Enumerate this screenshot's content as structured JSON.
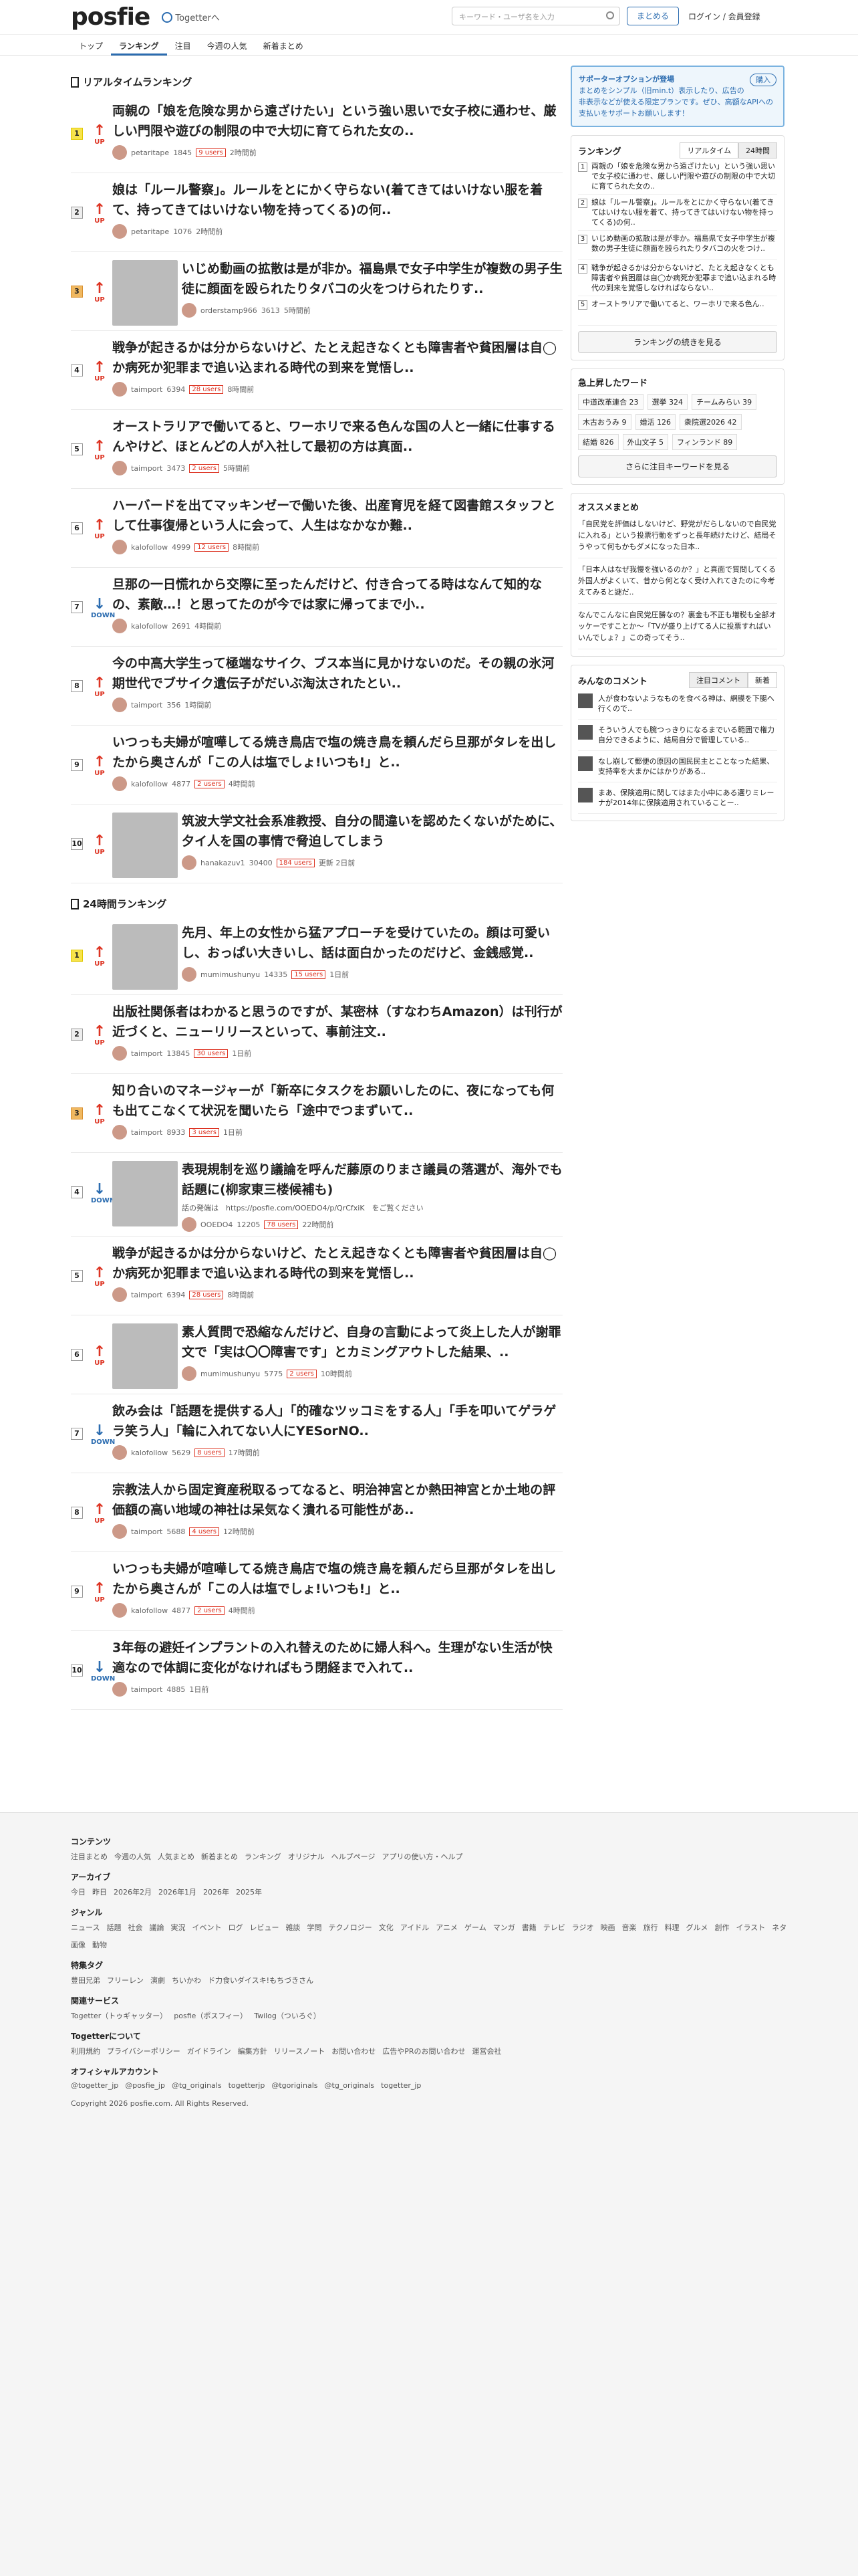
{
  "header": {
    "logo": "posfie",
    "togetter": "Togetterへ",
    "search_placeholder": "キーワード・ユーザ名を入力",
    "summary_btn": "まとめる",
    "login": "ログイン / 会員登録"
  },
  "nav": [
    "トップ",
    "ランキング",
    "注目",
    "今週の人気",
    "新着まとめ"
  ],
  "realtime_title": "リアルタイムランキング",
  "realtime": [
    {
      "r": "1",
      "dir": "UP",
      "title": "両親の「娘を危険な男から遠ざけたい」という強い思いで女子校に通わせ、厳しい門限や遊びの制限の中で大切に育てられた女の..",
      "user": "petaritape",
      "pv": "1845",
      "users": "9 users",
      "time": "2時間前"
    },
    {
      "r": "2",
      "dir": "UP",
      "title": "娘は「ルール警察」。ルールをとにかく守らない(着てきてはいけない服を着て、持ってきてはいけない物を持ってくる)の何..",
      "user": "petaritape",
      "pv": "1076",
      "users": "",
      "time": "2時間前"
    },
    {
      "r": "3",
      "dir": "UP",
      "title": "いじめ動画の拡散は是が非か。福島県で女子中学生が複数の男子生徒に顔面を殴られたりタバコの火をつけられたりす..",
      "user": "orderstamp966",
      "pv": "3613",
      "users": "",
      "time": "5時間前",
      "img": true
    },
    {
      "r": "4",
      "dir": "UP",
      "title": "戦争が起きるかは分からないけど、たとえ起きなくとも障害者や貧困層は自◯か病死か犯罪まで追い込まれる時代の到来を覚悟し..",
      "user": "taimport",
      "pv": "6394",
      "users": "28 users",
      "time": "8時間前"
    },
    {
      "r": "5",
      "dir": "UP",
      "title": "オーストラリアで働いてると、ワーホリで来る色んな国の人と一緒に仕事するんやけど、ほとんどの人が入社して最初の方は真面..",
      "user": "taimport",
      "pv": "3473",
      "users": "2 users",
      "time": "5時間前"
    },
    {
      "r": "6",
      "dir": "UP",
      "title": "ハーバードを出てマッキンゼーで働いた後、出産育児を経て図書館スタッフとして仕事復帰という人に会って、人生はなかなか難..",
      "user": "kalofollow",
      "pv": "4999",
      "users": "12 users",
      "time": "8時間前"
    },
    {
      "r": "7",
      "dir": "DOWN",
      "title": "旦那の一日慌れから交際に至ったんだけど、付き合ってる時はなんて知的なの、素敵…！と思ってたのが今では家に帰ってまで小..",
      "user": "kalofollow",
      "pv": "2691",
      "users": "",
      "time": "4時間前"
    },
    {
      "r": "8",
      "dir": "UP",
      "title": "今の中高大学生って極端なサイク、ブス本当に見かけないのだ。その親の氷河期世代でブサイク遺伝子がだいぶ淘汰されたとい..",
      "user": "taimport",
      "pv": "356",
      "users": "",
      "time": "1時間前"
    },
    {
      "r": "9",
      "dir": "UP",
      "title": "いつっも夫婦が喧嘩してる焼き鳥店で塩の焼き鳥を頼んだら旦那がタレを出したから奥さんが「この人は塩でしょ!いつも!」と..",
      "user": "kalofollow",
      "pv": "4877",
      "users": "2 users",
      "time": "4時間前"
    },
    {
      "r": "10",
      "dir": "UP",
      "title": "筑波大学文社会系准教授、自分の間違いを認めたくないがために、夕イ人を国の事情で脅迫してしまう",
      "user": "hanakazuv1",
      "pv": "30400",
      "users": "184 users",
      "time": "更新 2日前",
      "img": true
    }
  ],
  "daily_title": "24時間ランキング",
  "daily": [
    {
      "r": "1",
      "dir": "UP",
      "title": "先月、年上の女性から猛アプローチを受けていたの。顔は可愛いし、おっぱい大きいし、話は面白かったのだけど、金銭感覚..",
      "user": "mumimushunyu",
      "pv": "14335",
      "users": "15 users",
      "time": "1日前",
      "img": true
    },
    {
      "r": "2",
      "dir": "UP",
      "title": "出版社関係者はわかると思うのですが、某密林（すなわちAmazon）は刊行が近づくと、ニューリリースといって、事前注文..",
      "user": "taimport",
      "pv": "13845",
      "users": "30 users",
      "time": "1日前"
    },
    {
      "r": "3",
      "dir": "UP",
      "title": "知り合いのマネージャーが「新卒にタスクをお願いしたのに、夜になっても何も出てこなくて状況を聞いたら「途中でつまずいて..",
      "user": "taimport",
      "pv": "8933",
      "users": "3 users",
      "time": "1日前"
    },
    {
      "r": "4",
      "dir": "DOWN",
      "title": "表現規制を巡り議論を呼んだ藤原のりまさ議員の落選が、海外でも話題に(柳家東三楼候補も)",
      "user": "OOEDO4",
      "pv": "12205",
      "users": "78 users",
      "time": "22時間前",
      "img": true,
      "sub": "話の発端は　https://posfie.com/OOEDO4/p/QrCfxiK　をご覧ください"
    },
    {
      "r": "5",
      "dir": "UP",
      "title": "戦争が起きるかは分からないけど、たとえ起きなくとも障害者や貧困層は自◯か病死か犯罪まで追い込まれる時代の到来を覚悟し..",
      "user": "taimport",
      "pv": "6394",
      "users": "28 users",
      "time": "8時間前"
    },
    {
      "r": "6",
      "dir": "UP",
      "title": "素人質問で恐縮なんだけど、自身の言動によって炎上した人が謝罪文で「実は〇〇障害です」とカミングアウトした結果、..",
      "user": "mumimushunyu",
      "pv": "5775",
      "users": "2 users",
      "time": "10時間前",
      "img": true
    },
    {
      "r": "7",
      "dir": "DOWN",
      "title": "飲み会は「話題を提供する人」「的確なツッコミをする人」「手を叩いてゲラゲラ笑う人」「輪に入れてない人にYESorNO..",
      "user": "kalofollow",
      "pv": "5629",
      "users": "8 users",
      "time": "17時間前"
    },
    {
      "r": "8",
      "dir": "UP",
      "title": "宗教法人から固定資産税取るってなると、明治神宮とか熱田神宮とか土地の評価額の高い地域の神社は呆気なく潰れる可能性があ..",
      "user": "taimport",
      "pv": "5688",
      "users": "4 users",
      "time": "12時間前"
    },
    {
      "r": "9",
      "dir": "UP",
      "title": "いつっも夫婦が喧嘩してる焼き鳥店で塩の焼き鳥を頼んだら旦那がタレを出したから奥さんが「この人は塩でしょ!いつも!」と..",
      "user": "kalofollow",
      "pv": "4877",
      "users": "2 users",
      "time": "4時間前"
    },
    {
      "r": "10",
      "dir": "DOWN",
      "title": "3年毎の避妊インプラントの入れ替えのために婦人科へ。生理がない生活が快適なので体調に変化がなければもう閉経まで入れて..",
      "user": "taimport",
      "pv": "4885",
      "users": "",
      "time": "1日前"
    }
  ],
  "side": {
    "support_title": "サポーターオプションが登場",
    "support_btn": "購入",
    "support_text": "まとめをシンプル（旧min.t）表示したり、広告の非表示などが使える限定プランです。ぜひ、高額なAPIへの支払いをサポートお願いします！",
    "ranking": "ランキング",
    "tab1": "リアルタイム",
    "tab2": "24時間",
    "rk": [
      "両親の「娘を危険な男から遠ざけたい」という強い思いで女子校に通わせ、厳しい門限や遊びの制限の中で大切に育てられた女の..",
      "娘は「ルール警察」。ルールをとにかく守らない(着てきてはいけない服を着て、持ってきてはいけない物を持ってくる)の何..",
      "いじめ動画の拡散は是が非か。福島県で女子中学生が複数の男子生徒に顔面を殴られたりタバコの火をつけ..",
      "戦争が起きるかは分からないけど、たとえ起きなくとも障害者や貧困層は自◯か病死か犯罪まで追い込まれる時代の到来を覚悟しなければならない..",
      "オーストラリアで働いてると、ワーホリで来る色ん.."
    ],
    "rk_btn": "ランキングの続きを見る",
    "hot": "急上昇したワード",
    "tags": [
      "中道改革連合 23",
      "選挙 324",
      "チームみらい 39",
      "木古おうみ 9",
      "婚活 126",
      "衆院選2026 42",
      "結婚 826",
      "外山文子 5",
      "フィンランド 89"
    ],
    "hot_btn": "さらに注目キーワードを見る",
    "osusume": "オススメまとめ",
    "os": [
      "「自民党を評価はしないけど、野党がだらしないので自民党に入れる」という投票行動をずっと長年続けたけど、結局そうやって何もかもダメになった日本..",
      "「日本人はなぜ我慢を強いるのか？」と真面で質問してくる外国人がよくいて、昔から何となく受け入れてきたのに今考えてみると謎だ..",
      "なんでこんなに自民党圧勝なの？裏金も不正も増税も全部オッケーですことか〜「TVが盛り上げてる人に投票すればいいんでしょ？」この奇ってそう.."
    ],
    "comments": "みんなのコメント",
    "ctab1": "注目コメント",
    "ctab2": "新着",
    "cm": [
      "人が食わないようなものを食べる神は、網膜を下腸へ行くので..",
      "そういう人でも腕つっきりになるまでいる範囲で権力自分できるように、結局自分で管理している..",
      "なし崩して郵便の原因の国民民主とことなった結果、支持率を大まかにはかりがある..",
      "まあ、保険適用に関してはまた小中にある選りミレーナが2014年に保険適用されていることー.."
    ]
  },
  "footer": {
    "contents": "コンテンツ",
    "contents_links": [
      "注目まとめ",
      "今週の人気",
      "人気まとめ",
      "新着まとめ",
      "ランキング",
      "オリジナル",
      "ヘルプページ",
      "アプリの使い方・ヘルプ"
    ],
    "archive": "アーカイブ",
    "archive_links": [
      "今日",
      "昨日",
      "2026年2月",
      "2026年1月",
      "2026年",
      "2025年"
    ],
    "genre": "ジャンル",
    "genre_links": [
      "ニュース",
      "話題",
      "社会",
      "議論",
      "実況",
      "イベント",
      "ログ",
      "レビュー",
      "雑談",
      "学問",
      "テクノロジー",
      "文化",
      "アイドル",
      "アニメ",
      "ゲーム",
      "マンガ",
      "書籍",
      "テレビ",
      "ラジオ",
      "映画",
      "音楽",
      "旅行",
      "料理",
      "グルメ",
      "創作",
      "イラスト",
      "ネタ",
      "画像",
      "動物"
    ],
    "tag": "特集タグ",
    "tag_links": [
      "豊田兄弟",
      "フリーレン",
      "演劇",
      "ちいかわ",
      "ド力食いダイスキ!もちづきさん"
    ],
    "related": "関連サービス",
    "related_links": [
      "Togetter（トゥギャッター）",
      "posfie（ポスフィー）",
      "Twilog（ついろぐ）"
    ],
    "about": "Togetterについて",
    "about_links": [
      "利用規約",
      "プライバシーポリシー",
      "ガイドライン",
      "編集方針",
      "リリースノート",
      "お問い合わせ",
      "広告やPRのお問い合わせ",
      "運営会社"
    ],
    "official": "オフィシャルアカウント",
    "official_links": [
      "@togetter_jp",
      "@posfie_jp",
      "@tg_originals",
      "togetterjp",
      "@tgoriginals",
      "@tg_originals",
      "togetter_jp"
    ],
    "copyright": "Copyright 2026 posfie.com. All Rights Reserved."
  }
}
